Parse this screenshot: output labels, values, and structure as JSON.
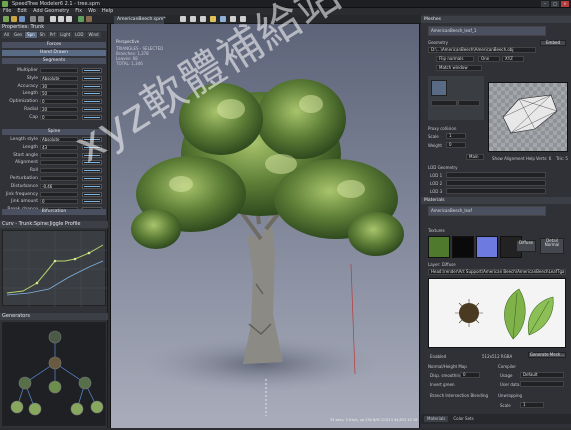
{
  "window": {
    "title": "SpeedTree Modeler6 2.1 - tree.spm"
  },
  "menu": [
    "File",
    "Edit",
    "Add Geometry",
    "Fix",
    "Wo",
    "Help"
  ],
  "properties": {
    "title": "Properties: Trunk",
    "tabs": [
      "All",
      "Gen",
      "Spn",
      "Sh",
      "Prf",
      "Light",
      "Lighting",
      "LOD",
      "Wind"
    ],
    "active_tab": "Spn",
    "forces_label": "Forces",
    "hand_drawn_label": "Hand Drawn",
    "segments_label": "Segments",
    "spine_label": "Spine",
    "bifurcation_label": "Bifurcation",
    "rows_top": [
      {
        "label": "Multiplier",
        "value": ""
      },
      {
        "label": "Style",
        "value": "Absolute"
      },
      {
        "label": "Accuracy",
        "value": "30"
      },
      {
        "label": "Length",
        "value": "50"
      },
      {
        "label": "Optimization",
        "value": "0"
      },
      {
        "label": "Radial",
        "value": "20"
      },
      {
        "label": "Cap",
        "value": "0"
      }
    ],
    "rows_spine": [
      {
        "label": "Length style",
        "value": "Absolute"
      },
      {
        "label": "Length",
        "value": "43"
      },
      {
        "label": "Start angle",
        "value": ""
      },
      {
        "label": "Alignment",
        "value": ""
      },
      {
        "label": "Roll",
        "value": ""
      },
      {
        "label": "Perturbation",
        "value": ""
      },
      {
        "label": "Disturbance",
        "value": "-0.46"
      },
      {
        "label": "Jink frequency",
        "value": ""
      },
      {
        "label": "Jink amount",
        "value": "0"
      },
      {
        "label": "Break chance",
        "value": ""
      }
    ],
    "curve_title": "Curv - Trunk:Spine:Jiggle Profile",
    "generators_title": "Generators"
  },
  "viewport": {
    "tab_label": "AmericanBeech.spm*",
    "view_title": "Perspective",
    "stats": [
      "TRIANGLES - SELECTED",
      "Branches: 1,378",
      "Leaves: 68",
      "TOTAL: 1,346"
    ],
    "status_line": "34 secs, 3 tris/s, vp 236 B/M    22,813 44,833 45 16"
  },
  "meshes": {
    "title": "Meshes",
    "mesh_name": "AmericanBeech_leaf_1",
    "geometry_label": "Geometry",
    "path_value": "D:\\...\\AmericanBeech\\AmericanBeech.obj",
    "embed_button": "Embed",
    "flip_normals_label": "Flip normals",
    "one_label": "One",
    "xyz_label": "XYZ",
    "match_window_label": "Match window",
    "proxy_label": "Proxy collision",
    "scale_label": "Scale",
    "scale_value": "1",
    "weight_label": "Weight",
    "weight_value": "0",
    "main_label": "Main",
    "show_alignment_help": "Show Alignment Help",
    "verts_label": "Verts: 6",
    "tris_label": "Tris: 5",
    "lod_label": "LOD Geometry",
    "lod1": "LOD 1",
    "lod2": "LOD 2",
    "lod3": "LOD 3"
  },
  "materials": {
    "title": "Materials",
    "material_name": "AmericanBeech_leaf",
    "textures_label": "Textures",
    "diffuse_button": "Diffuse",
    "detail_button": "Detail Normal",
    "layer_label": "Layer: Diffuse",
    "path": "Head:\\render\\Art Support\\American Beech\\AmericanBeechLeafTga",
    "enabled_label": "Enabled",
    "size_label": "512x512 RGBA",
    "generate_button": "Generate Mesh...",
    "normal_height_label": "Normal/Height Map",
    "disp_smoothing_label": "Disp. smoothing",
    "disp_smoothing_value": "0",
    "invert_green_label": "Invert green",
    "compiler_label": "Compiler",
    "usage_label": "Usage",
    "usage_value": "Default",
    "user_data_label": "User data",
    "branch_blending_label": "Branch Intersection Blending",
    "unwrapping_label": "Unwrapping",
    "scale_label": "Scale",
    "scale_value": "1",
    "bottom_tabs": [
      "Materials",
      "Color Sets"
    ]
  },
  "watermark": "xyz軟體補給站 http://31.to",
  "colors": {
    "accent": "#5a6b85",
    "panel": "#303237",
    "title": "#3c3f45"
  }
}
